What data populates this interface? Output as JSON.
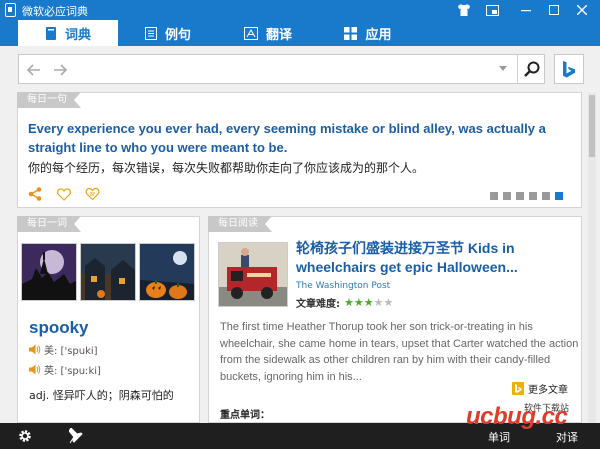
{
  "window": {
    "title": "微软必应词典",
    "controls": [
      "shirt-icon",
      "mini-mode-icon",
      "minimize-icon",
      "maximize-icon",
      "close-icon"
    ]
  },
  "tabs": [
    {
      "label": "词典",
      "icon": "book-icon",
      "active": true
    },
    {
      "label": "例句",
      "icon": "document-icon",
      "active": false
    },
    {
      "label": "翻译",
      "icon": "translate-icon",
      "active": false
    },
    {
      "label": "应用",
      "icon": "apps-icon",
      "active": false
    }
  ],
  "search": {
    "value": "",
    "placeholder": ""
  },
  "daily_sentence": {
    "tag": "每日一句",
    "english": "Every experience you ever had, every seeming mistake or blind alley, was actually a straight line to who you were meant to be.",
    "chinese": "你的每个经历，每次错误，每次失败都帮助你走向了你应该成为的那个人。",
    "pages": 6,
    "current_page": 6
  },
  "word_of_day": {
    "tag": "每日一词",
    "word": "spooky",
    "pron_us": "美: ['spuki]",
    "pron_uk": "英: ['spuːki]",
    "definition": "adj. 怪异吓人的；阴森可怕的"
  },
  "daily_reading": {
    "tag": "每日阅读",
    "title": "轮椅孩子们盛装进接万圣节 Kids in wheelchairs get epic Halloween...",
    "source": "The Washington Post",
    "difficulty_label": "文章难度:",
    "difficulty_stars": 3,
    "difficulty_max": 5,
    "body": "The first time Heather Thorup took her son trick-or-treating in his wheelchair, she came home in tears, upset that Carter watched the action from the sidewalk as other children ran by him with their candy-filled buckets, ignoring him in his...",
    "more_label": "更多文章",
    "key_words_label": "重点单词："
  },
  "bottom_bar": {
    "words_label": "单词",
    "vocab_label": "对译"
  },
  "watermark": {
    "main": "ucbug.cc",
    "sub": "软件下载站"
  },
  "colors": {
    "brand_blue": "#1979ca",
    "link_blue": "#1a5ea8",
    "star_green": "#4caa2f",
    "share_orange": "#e8931a",
    "bottom_bar": "#1f1f1f"
  }
}
